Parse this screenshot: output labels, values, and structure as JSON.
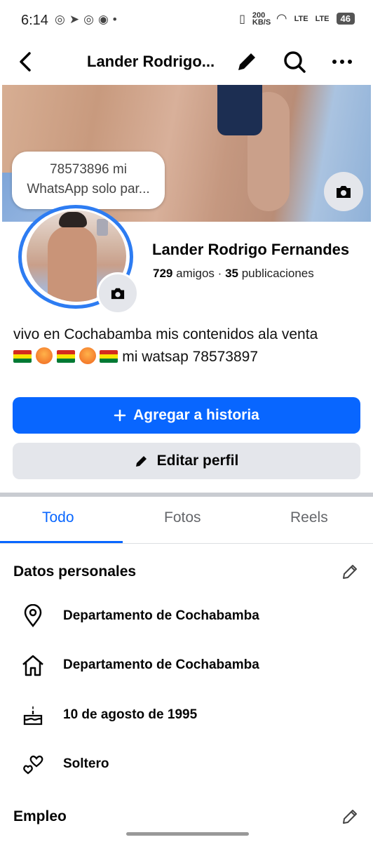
{
  "status_bar": {
    "time": "6:14",
    "right_text": "200 KB/S",
    "network_1": "LTE",
    "network_2": "LTE",
    "battery": "46"
  },
  "header": {
    "title": "Lander Rodrigo..."
  },
  "note_bubble": {
    "line1": "78573896 mi",
    "line2": "WhatsApp solo par..."
  },
  "profile": {
    "name": "Lander Rodrigo Fernandes",
    "friends_count": "729",
    "friends_label": "amigos",
    "separator": "·",
    "posts_count": "35",
    "posts_label": "publicaciones",
    "bio_line1": "vivo en Cochabamba mis contenidos ala venta",
    "bio_line2_text": "mi watsap 78573897"
  },
  "buttons": {
    "add_story": "Agregar a historia",
    "edit_profile": "Editar perfil"
  },
  "tabs": [
    {
      "label": "Todo",
      "active": true
    },
    {
      "label": "Fotos",
      "active": false
    },
    {
      "label": "Reels",
      "active": false
    }
  ],
  "personal_details": {
    "title": "Datos personales",
    "items": [
      {
        "icon": "location-pin-icon",
        "text": "Departamento de Cochabamba"
      },
      {
        "icon": "home-icon",
        "text": "Departamento de Cochabamba"
      },
      {
        "icon": "birthday-cake-icon",
        "text": "10 de agosto de 1995"
      },
      {
        "icon": "relationship-hearts-icon",
        "text": "Soltero"
      }
    ]
  },
  "employment": {
    "title": "Empleo"
  },
  "colors": {
    "accent": "#0866ff",
    "secondary_button": "#e4e6eb",
    "avatar_ring": "#2d7cf2"
  }
}
